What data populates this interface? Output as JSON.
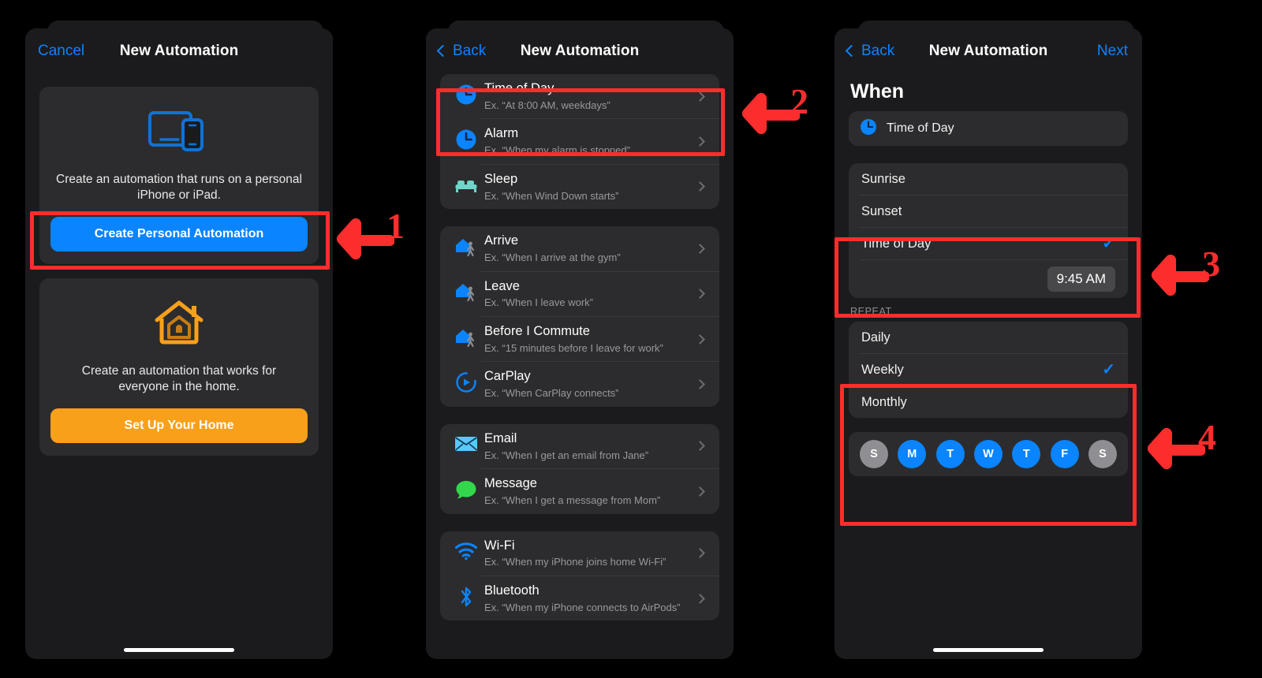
{
  "colors": {
    "accent_blue": "#0a84ff",
    "accent_orange": "#f9a01b",
    "highlight_red": "#fc2d2d",
    "panel_bg": "#1b1b1d",
    "card_bg": "#2c2c2e",
    "day_off_gray": "#8e8e93",
    "bed_teal": "#6fd6c9",
    "message_green": "#32d74b"
  },
  "panel1": {
    "nav": {
      "cancel_label": "Cancel",
      "title": "New Automation"
    },
    "personal_card": {
      "icon": "devices-ipad-iphone-icon",
      "description": "Create an automation that runs on a personal iPhone or iPad.",
      "button_label": "Create Personal Automation"
    },
    "home_card": {
      "icon": "home-house-icon",
      "description": "Create an automation that works for everyone in the home.",
      "button_label": "Set Up Your Home"
    }
  },
  "panel2": {
    "nav": {
      "back_label": "Back",
      "title": "New Automation"
    },
    "groups": [
      {
        "rows": [
          {
            "icon": "clock-icon",
            "title": "Time of Day",
            "example": "Ex. “At 8:00 AM, weekdays”"
          },
          {
            "icon": "clock-icon",
            "title": "Alarm",
            "example": "Ex. “When my alarm is stopped”"
          },
          {
            "icon": "bed-icon",
            "title": "Sleep",
            "example": "Ex. “When Wind Down starts”"
          }
        ]
      },
      {
        "rows": [
          {
            "icon": "person-arrive-icon",
            "title": "Arrive",
            "example": "Ex. “When I arrive at the gym”"
          },
          {
            "icon": "person-leave-icon",
            "title": "Leave",
            "example": "Ex. “When I leave work”"
          },
          {
            "icon": "person-commute-icon",
            "title": "Before I Commute",
            "example": "Ex. “15 minutes before I leave for work”"
          },
          {
            "icon": "carplay-icon",
            "title": "CarPlay",
            "example": "Ex. “When CarPlay connects”"
          }
        ]
      },
      {
        "rows": [
          {
            "icon": "email-icon",
            "title": "Email",
            "example": "Ex. “When I get an email from Jane”"
          },
          {
            "icon": "message-icon",
            "title": "Message",
            "example": "Ex. “When I get a message from Mom”"
          }
        ]
      },
      {
        "rows": [
          {
            "icon": "wifi-icon",
            "title": "Wi-Fi",
            "example": "Ex. “When my iPhone joins home Wi-Fi”"
          },
          {
            "icon": "bluetooth-icon",
            "title": "Bluetooth",
            "example": "Ex. “When my iPhone connects to AirPods”"
          }
        ]
      }
    ]
  },
  "panel3": {
    "nav": {
      "back_label": "Back",
      "title": "New Automation",
      "next_label": "Next"
    },
    "section_title": "When",
    "trigger": {
      "icon": "clock-icon",
      "label": "Time of Day"
    },
    "time_options": [
      {
        "label": "Sunrise",
        "selected": false
      },
      {
        "label": "Sunset",
        "selected": false
      },
      {
        "label": "Time of Day",
        "selected": true
      }
    ],
    "selected_time": "9:45 AM",
    "repeat_header": "REPEAT",
    "repeat_options": [
      {
        "label": "Daily",
        "selected": false
      },
      {
        "label": "Weekly",
        "selected": true
      },
      {
        "label": "Monthly",
        "selected": false
      }
    ],
    "days": [
      {
        "letter": "S",
        "selected": false
      },
      {
        "letter": "M",
        "selected": true
      },
      {
        "letter": "T",
        "selected": true
      },
      {
        "letter": "W",
        "selected": true
      },
      {
        "letter": "T",
        "selected": true
      },
      {
        "letter": "F",
        "selected": true
      },
      {
        "letter": "S",
        "selected": false
      }
    ]
  },
  "annotations": [
    {
      "number": "1"
    },
    {
      "number": "2"
    },
    {
      "number": "3"
    },
    {
      "number": "4"
    }
  ]
}
